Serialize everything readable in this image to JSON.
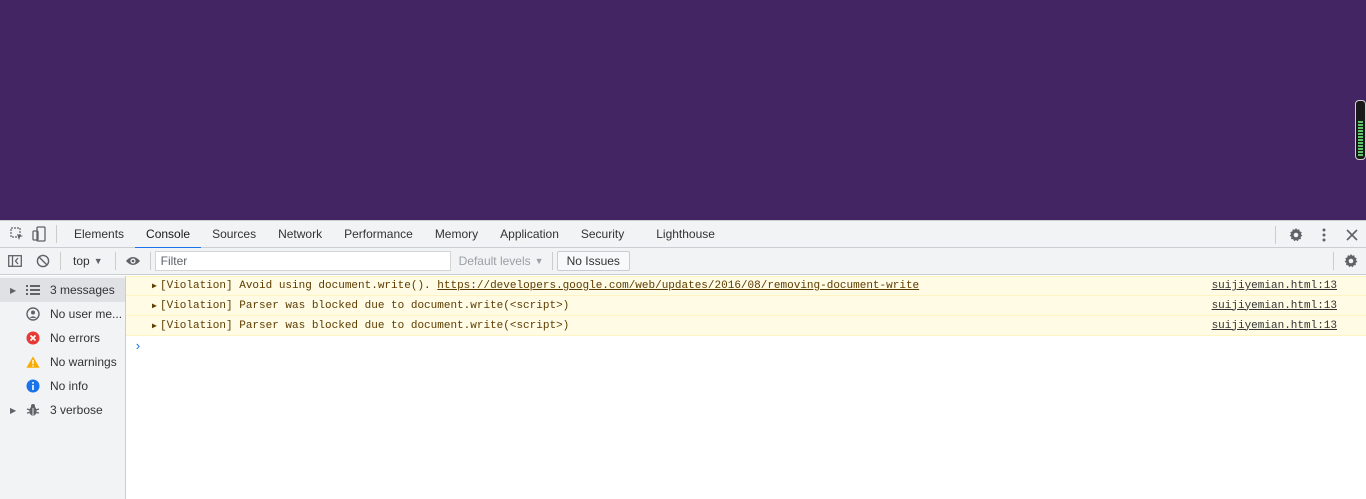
{
  "tabs": [
    {
      "label": "Elements"
    },
    {
      "label": "Console"
    },
    {
      "label": "Sources"
    },
    {
      "label": "Network"
    },
    {
      "label": "Performance"
    },
    {
      "label": "Memory"
    },
    {
      "label": "Application"
    },
    {
      "label": "Security"
    },
    {
      "label": "Lighthouse"
    }
  ],
  "active_tab": "Console",
  "toolbar": {
    "context": "top",
    "filter_placeholder": "Filter",
    "levels": "Default levels",
    "issues": "No Issues"
  },
  "sidebar": {
    "items": [
      {
        "label": "3 messages",
        "icon": "list-icon",
        "expandable": true
      },
      {
        "label": "No user me...",
        "icon": "user-icon",
        "expandable": false
      },
      {
        "label": "No errors",
        "icon": "error-icon",
        "expandable": false
      },
      {
        "label": "No warnings",
        "icon": "warning-icon",
        "expandable": false
      },
      {
        "label": "No info",
        "icon": "info-icon",
        "expandable": false
      },
      {
        "label": "3 verbose",
        "icon": "bug-icon",
        "expandable": true
      }
    ]
  },
  "messages": [
    {
      "text": "[Violation] Avoid using document.write().",
      "link": "https://developers.google.com/web/updates/2016/08/removing-document-write",
      "source": "suijiyemian.html:13"
    },
    {
      "text": "[Violation] Parser was blocked due to document.write(<script>)",
      "link": "",
      "source": "suijiyemian.html:13"
    },
    {
      "text": "[Violation] Parser was blocked due to document.write(<script>)",
      "link": "",
      "source": "suijiyemian.html:13"
    }
  ],
  "colors": {
    "page_background": "#422562",
    "accent": "#1a73e8",
    "warning_background": "#fffbe5"
  }
}
